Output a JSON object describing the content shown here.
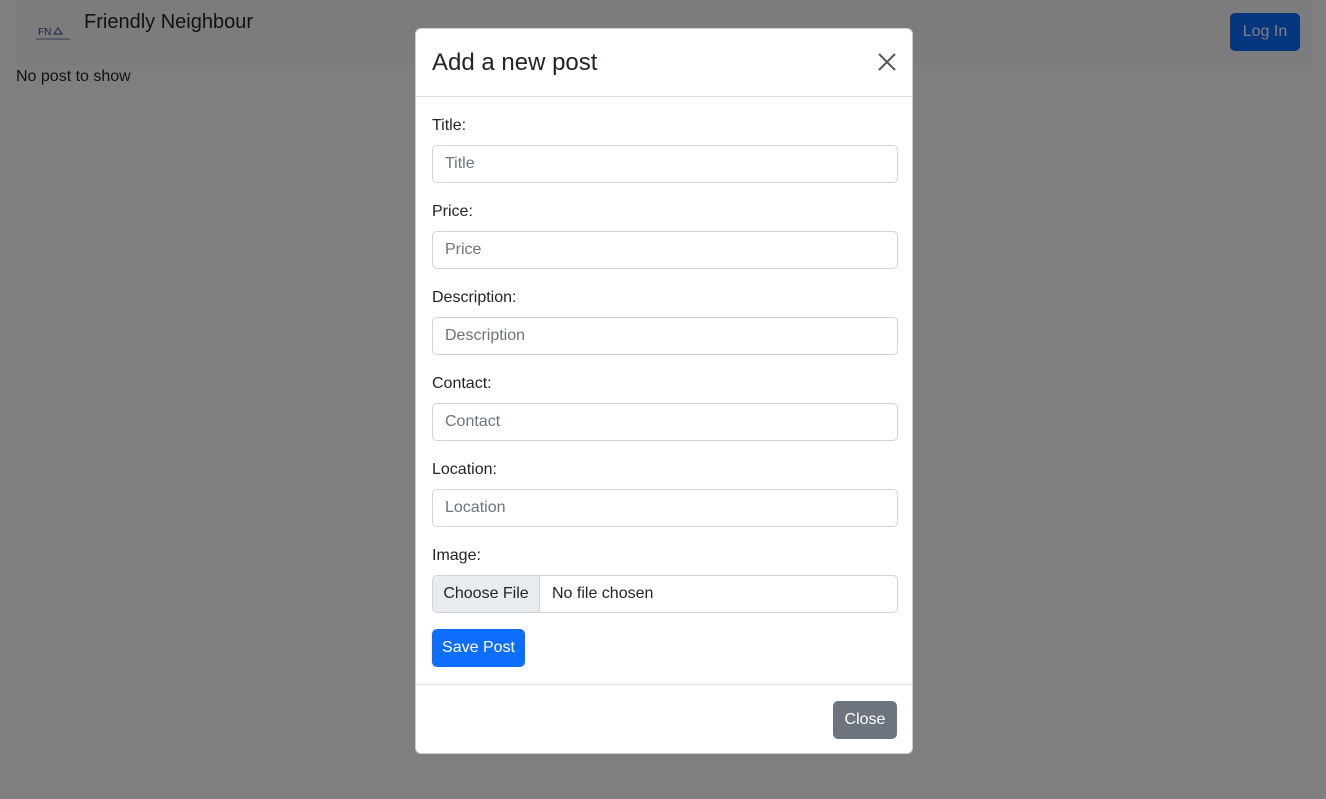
{
  "navbar": {
    "brand_title": "Friendly Neighbour",
    "logo_text": "FN",
    "login_label": "Log In"
  },
  "main": {
    "empty_message": "No post to show"
  },
  "modal": {
    "title": "Add a new post",
    "fields": {
      "title": {
        "label": "Title:",
        "placeholder": "Title"
      },
      "price": {
        "label": "Price:",
        "placeholder": "Price"
      },
      "description": {
        "label": "Description:",
        "placeholder": "Description"
      },
      "contact": {
        "label": "Contact:",
        "placeholder": "Contact"
      },
      "location": {
        "label": "Location:",
        "placeholder": "Location"
      },
      "image": {
        "label": "Image:",
        "button_label": "Choose File",
        "status": "No file chosen"
      }
    },
    "save_label": "Save Post",
    "close_label": "Close"
  },
  "colors": {
    "primary": "#0d6efd",
    "secondary": "#6c757d",
    "backdrop": "rgba(0,0,0,0.5)"
  }
}
